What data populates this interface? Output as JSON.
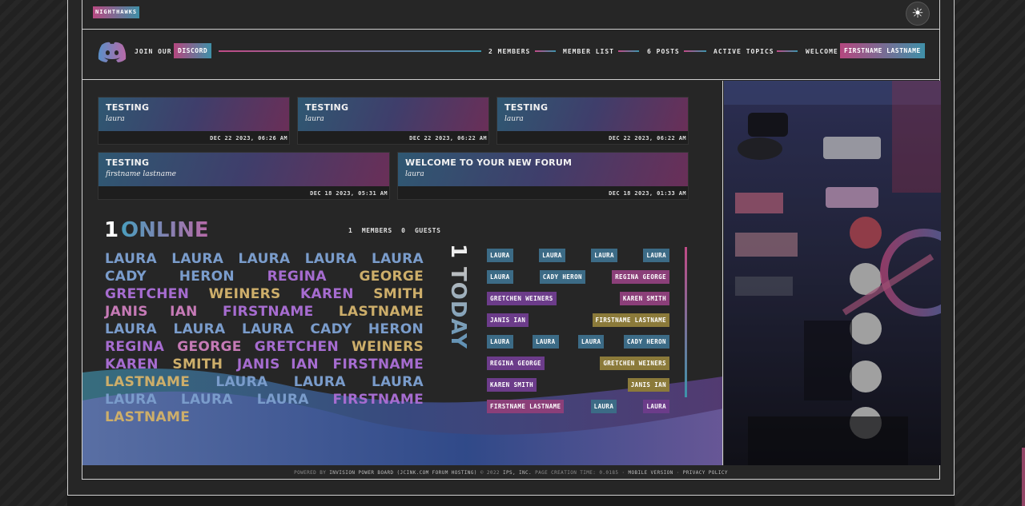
{
  "header": {
    "logo": "NIGHTHAWKS",
    "theme_icon": "sun-icon"
  },
  "nav": {
    "join_label": "JOIN OUR",
    "discord": "DISCORD",
    "members": "2 MEMBERS",
    "member_list": "MEMBER LIST",
    "posts": "6 POSTS",
    "active_topics": "ACTIVE TOPICS",
    "welcome": "WELCOME",
    "user": "FIRSTNAME LASTNAME"
  },
  "topics": [
    {
      "title": "TESTING",
      "author": "laura",
      "date": "DEC 22 2023, 06:26 AM"
    },
    {
      "title": "TESTING",
      "author": "laura",
      "date": "DEC 22 2023, 06:22 AM"
    },
    {
      "title": "TESTING",
      "author": "laura",
      "date": "DEC 22 2023, 06:22 AM"
    },
    {
      "title": "TESTING",
      "author": "firstname lastname",
      "date": "DEC 18 2023, 05:31 AM"
    },
    {
      "title": "WELCOME TO YOUR NEW FORUM",
      "author": "laura",
      "date": "DEC 18 2023, 01:33 AM"
    }
  ],
  "online": {
    "count": "1",
    "label": "ONLINE",
    "members": "1 MEMBERS",
    "guests": "0 GUESTS",
    "names": [
      {
        "n": "LAURA",
        "c": "blue"
      },
      {
        "n": "LAURA",
        "c": "blue"
      },
      {
        "n": "LAURA",
        "c": "blue"
      },
      {
        "n": "LAURA",
        "c": "blue"
      },
      {
        "n": "LAURA",
        "c": "blue"
      },
      {
        "n": "CADY",
        "c": "blue"
      },
      {
        "n": "HERON",
        "c": "blue"
      },
      {
        "n": "REGINA",
        "c": "violet"
      },
      {
        "n": "GEORGE",
        "c": "gold"
      },
      {
        "n": "GRETCHEN",
        "c": "violet"
      },
      {
        "n": "WEINERS",
        "c": "gold"
      },
      {
        "n": "KAREN",
        "c": "violet"
      },
      {
        "n": "SMITH",
        "c": "gold"
      },
      {
        "n": "JANIS IAN",
        "c": "pink"
      },
      {
        "n": "FIRSTNAME",
        "c": "violet"
      },
      {
        "n": "LASTNAME",
        "c": "gold"
      },
      {
        "n": "LAURA",
        "c": "blue"
      },
      {
        "n": "LAURA",
        "c": "blue"
      },
      {
        "n": "LAURA",
        "c": "blue"
      },
      {
        "n": "CADY",
        "c": "blue"
      },
      {
        "n": "HERON",
        "c": "blue"
      },
      {
        "n": "REGINA",
        "c": "violet"
      },
      {
        "n": "GEORGE",
        "c": "pink"
      },
      {
        "n": "GRETCHEN",
        "c": "violet"
      },
      {
        "n": "WEINERS",
        "c": "gold"
      },
      {
        "n": "KAREN",
        "c": "violet"
      },
      {
        "n": "SMITH",
        "c": "gold"
      },
      {
        "n": "JANIS IAN",
        "c": "violet"
      },
      {
        "n": "FIRSTNAME",
        "c": "violet"
      },
      {
        "n": "LASTNAME",
        "c": "gold"
      },
      {
        "n": "LAURA",
        "c": "blue"
      },
      {
        "n": "LAURA",
        "c": "blue"
      },
      {
        "n": "LAURA",
        "c": "blue"
      },
      {
        "n": "LAURA",
        "c": "blue"
      },
      {
        "n": "LAURA",
        "c": "blue"
      },
      {
        "n": "LAURA",
        "c": "blue"
      },
      {
        "n": "FIRSTNAME",
        "c": "violet"
      },
      {
        "n": "LASTNAME",
        "c": "gold"
      }
    ]
  },
  "today": {
    "count": "1",
    "label": "TODAY",
    "tags": [
      {
        "n": "LAURA",
        "c": "blue"
      },
      {
        "n": "LAURA",
        "c": "blue"
      },
      {
        "n": "LAURA",
        "c": "blue"
      },
      {
        "n": "LAURA",
        "c": "blue"
      },
      {
        "n": "LAURA",
        "c": "blue"
      },
      {
        "n": "CADY HERON",
        "c": "blue"
      },
      {
        "n": "REGINA GEORGE",
        "c": "pink"
      },
      {
        "n": "GRETCHEN WEINERS",
        "c": "violet"
      },
      {
        "n": "KAREN SMITH",
        "c": "pink"
      },
      {
        "n": "JANIS IAN",
        "c": "violet"
      },
      {
        "n": "FIRSTNAME LASTNAME",
        "c": "gold"
      },
      {
        "n": "LAURA",
        "c": "blue"
      },
      {
        "n": "LAURA",
        "c": "blue"
      },
      {
        "n": "LAURA",
        "c": "blue"
      },
      {
        "n": "CADY HERON",
        "c": "blue"
      },
      {
        "n": "REGINA GEORGE",
        "c": "violet"
      },
      {
        "n": "GRETCHEN WEINERS",
        "c": "gold"
      },
      {
        "n": "KAREN SMITH",
        "c": "violet"
      },
      {
        "n": "JANIS IAN",
        "c": "gold"
      },
      {
        "n": "FIRSTNAME LASTNAME",
        "c": "pink"
      },
      {
        "n": "LAURA",
        "c": "blue"
      },
      {
        "n": "LAURA",
        "c": "violet"
      }
    ]
  },
  "footer": {
    "powered": "POWERED BY",
    "ipb": "INVISION POWER BOARD",
    "hosting": "(JCINK.COM FORUM HOSTING)",
    "copy": "© 2022",
    "ips": "IPS, INC.",
    "page_time": "PAGE CREATION TIME: 0.0185",
    "mobile": "MOBILE VERSION",
    "privacy": "PRIVACY POLICY"
  },
  "colors": {
    "accent_pink": "#c04a86",
    "accent_teal": "#3c94ab"
  }
}
